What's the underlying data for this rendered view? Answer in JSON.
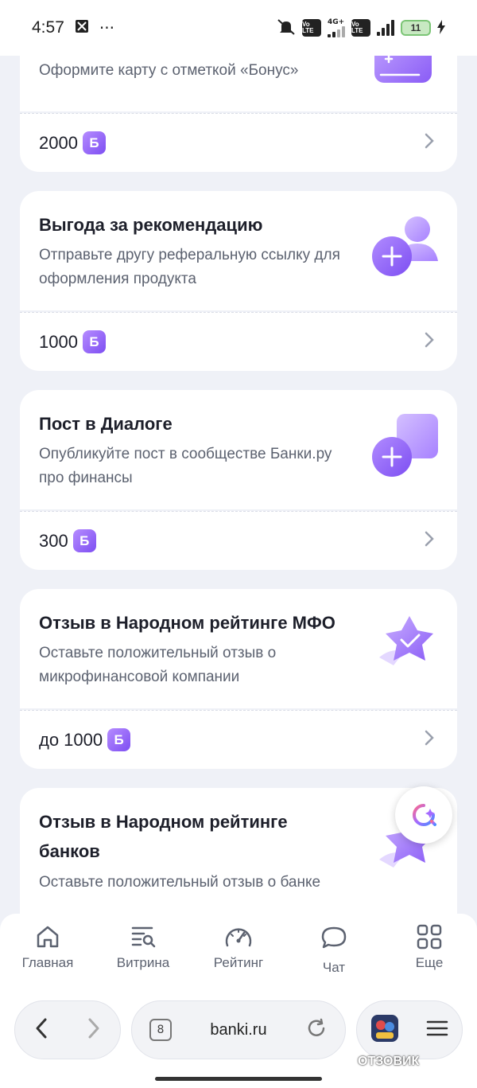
{
  "status_bar": {
    "time": "4:57",
    "more": "···",
    "network_label": "4G+",
    "volte_label_1": "Vo LTE",
    "volte_label_2": "Vo LTE",
    "battery": "11"
  },
  "cards": [
    {
      "title": "",
      "description": "Оформите карту с отметкой «Бонус»",
      "reward": "2000",
      "icon": "card-plus-icon"
    },
    {
      "title": "Выгода за рекомендацию",
      "description": "Отправьте другу реферальную ссылку для оформления продукта",
      "reward": "1000",
      "icon": "user-plus-icon"
    },
    {
      "title": "Пост в Диалоге",
      "description": "Опубликуйте пост в сообществе Банки.ру про финансы",
      "reward": "300",
      "icon": "post-plus-icon"
    },
    {
      "title": "Отзыв в Народном рейтинге МФО",
      "description": "Оставьте положительный отзыв о микрофинансовой компании",
      "reward": "до 1000",
      "icon": "star-check-icon"
    },
    {
      "title": "Отзыв в Народном рейтинге банков",
      "description": "Оставьте положительный отзыв о банке",
      "reward": "",
      "icon": "star-check-icon"
    }
  ],
  "badge_letter": "Б",
  "bottom_nav": [
    {
      "label": "Главная",
      "icon": "home-icon"
    },
    {
      "label": "Витрина",
      "icon": "showcase-icon"
    },
    {
      "label": "Рейтинг",
      "icon": "speedometer-icon"
    },
    {
      "label": "Чат",
      "icon": "chat-icon"
    },
    {
      "label": "Еще",
      "icon": "grid-icon"
    }
  ],
  "browser": {
    "tabs_count": "8",
    "url": "banki.ru"
  },
  "watermark": "ОТЗОВИК",
  "colors": {
    "accent": "#8a5cf6",
    "background": "#eff1f7"
  }
}
